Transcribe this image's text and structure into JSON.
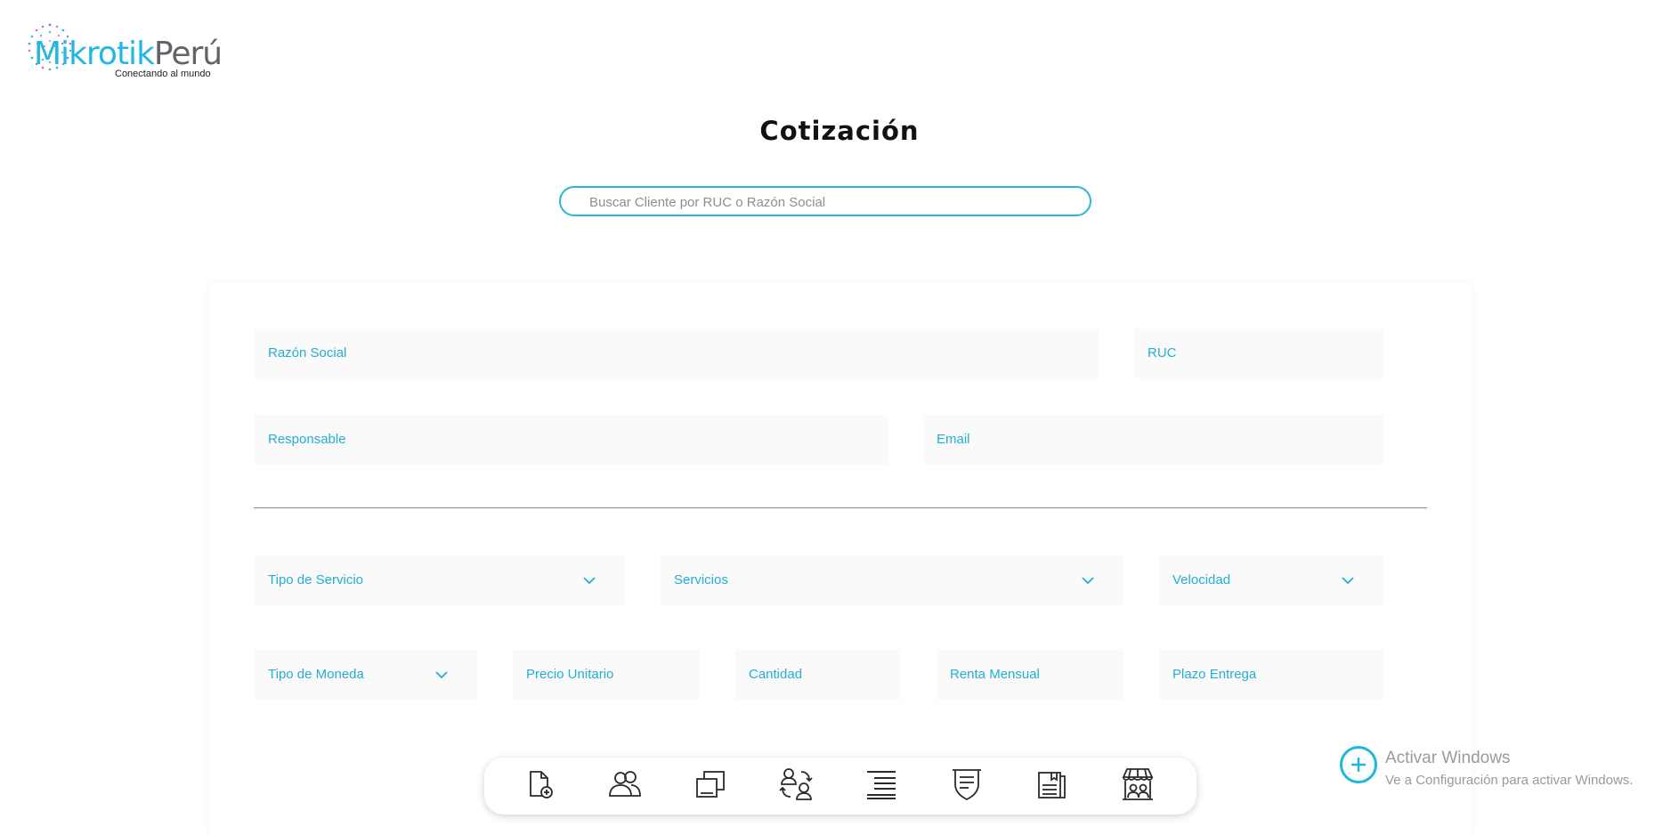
{
  "logo": {
    "brand_part1": "Mikrotik",
    "brand_part2": "Perú",
    "tagline": "Conectando al mundo"
  },
  "page": {
    "title": "Cotización"
  },
  "search": {
    "placeholder": "Buscar Cliente por RUC o Razón Social",
    "value": ""
  },
  "client_fields": {
    "razon_social": "Razón Social",
    "ruc": "RUC",
    "responsable": "Responsable",
    "email": "Email"
  },
  "service_fields": {
    "tipo_servicio": "Tipo de Servicio",
    "servicios": "Servicios",
    "velocidad": "Velocidad",
    "tipo_moneda": "Tipo de Moneda",
    "precio_unitario": "Precio Unitario",
    "cantidad": "Cantidad",
    "renta_mensual": "Renta Mensual",
    "plazo_entrega": "Plazo Entrega"
  },
  "dock": {
    "icons": [
      "new-document-icon",
      "users-icon",
      "devices-icon",
      "customer-exchange-icon",
      "list-icon",
      "shield-list-icon",
      "catalog-icon",
      "store-icon"
    ]
  },
  "watermark": {
    "title": "Activar Windows",
    "subtitle": "Ve a Configuración para activar Windows."
  },
  "colors": {
    "accent": "#25aed3",
    "search_border": "#2bb6d6",
    "field_bg": "#fafafa",
    "watermark_text": "#9a9a9a"
  }
}
